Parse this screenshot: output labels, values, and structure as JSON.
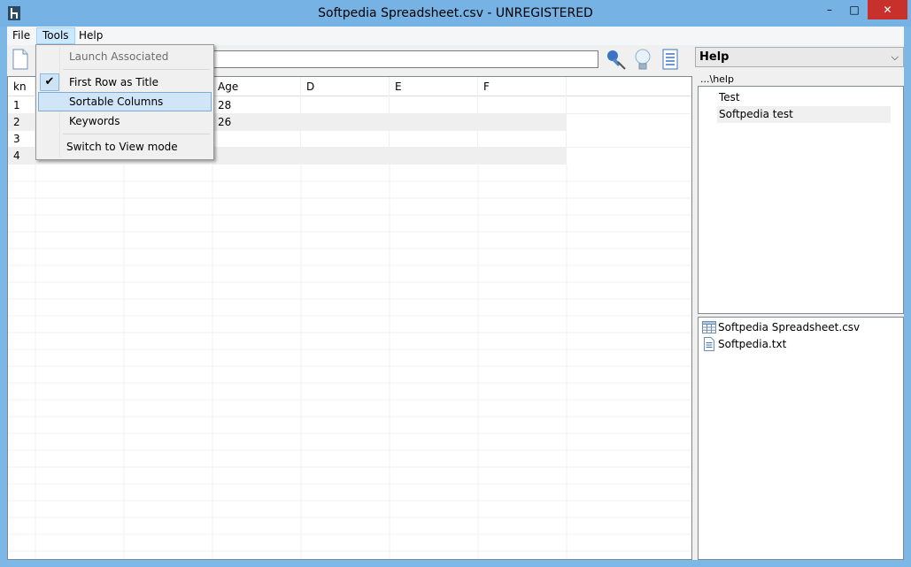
{
  "window": {
    "title": "Softpedia Spreadsheet.csv - UNREGISTERED",
    "minimize_glyph": "–",
    "maximize_glyph": "□",
    "close_glyph": "✕"
  },
  "menubar": {
    "file": "File",
    "tools": "Tools",
    "help": "Help"
  },
  "tools_menu": {
    "items": [
      {
        "label": "Launch Associated",
        "state": "disabled"
      },
      {
        "label": "First Row as Title",
        "state": "checked"
      },
      {
        "label": "Sortable Columns",
        "state": "hover"
      },
      {
        "label": "Keywords",
        "state": "normal"
      },
      {
        "label": "Switch to View mode",
        "state": "normal"
      }
    ],
    "check_glyph": "✔"
  },
  "toolbar": {
    "formula_value": ""
  },
  "grid": {
    "headers": [
      "kn",
      "",
      "",
      "Age",
      "D",
      "E",
      "F"
    ],
    "rows": [
      [
        "1",
        "",
        "",
        "28",
        "",
        "",
        ""
      ],
      [
        "2",
        "",
        "",
        "26",
        "",
        "",
        ""
      ],
      [
        "3",
        "",
        "",
        "",
        "",
        "",
        ""
      ],
      [
        "4",
        "",
        "",
        "",
        "",
        "",
        ""
      ]
    ]
  },
  "help_panel": {
    "selector_label": "Help",
    "path": "...\\help",
    "tree_items": [
      "Test",
      "Softpedia test"
    ],
    "files": [
      {
        "name": "Softpedia Spreadsheet.csv",
        "icon": "spreadsheet-file-icon"
      },
      {
        "name": "Softpedia.txt",
        "icon": "text-file-icon"
      }
    ]
  },
  "colors": {
    "titlebar": "#76b2e3",
    "close_button": "#c7302b",
    "menu_highlight": "#cce8ff"
  }
}
